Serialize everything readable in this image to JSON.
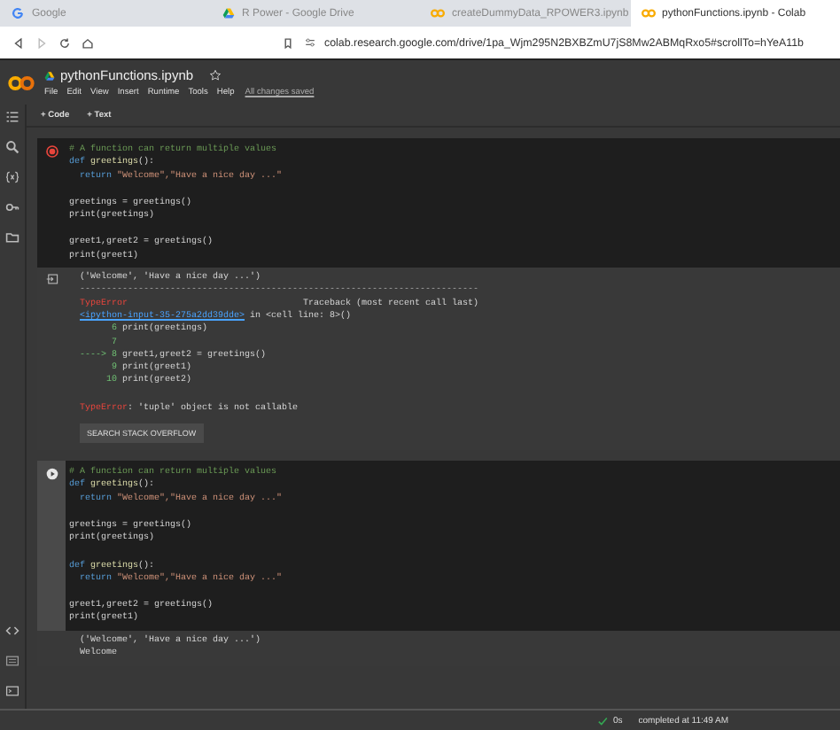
{
  "browser_tabs": [
    {
      "label": "Google",
      "kind": "google",
      "selected": false
    },
    {
      "label": "R Power - Google Drive",
      "kind": "drive",
      "selected": false
    },
    {
      "label": "createDummyData_RPOWER3.ipynb",
      "kind": "colab",
      "selected": false
    },
    {
      "label": "pythonFunctions.ipynb - Colab",
      "kind": "colab",
      "selected": true
    }
  ],
  "address_bar": {
    "url": "colab.research.google.com/drive/1pa_Wjm295N2BXBZmU7jS8Mw2ABMqRxo5#scrollTo=hYeA11b"
  },
  "notebook": {
    "title": "pythonFunctions.ipynb",
    "menu": [
      "File",
      "Edit",
      "View",
      "Insert",
      "Runtime",
      "Tools",
      "Help"
    ],
    "save_status": "All changes saved"
  },
  "toolbar": [
    "+ Code",
    "+ Text"
  ],
  "cells": [
    {
      "error": true,
      "code": [
        {
          "tokens": [
            {
              "kind": "comment",
              "text": "# A function can return multiple values"
            }
          ]
        },
        {
          "tokens": [
            {
              "kind": "keyword",
              "text": "def "
            },
            {
              "kind": "function",
              "text": "greetings"
            },
            {
              "kind": "plain",
              "text": "():"
            }
          ]
        },
        {
          "tokens": [
            {
              "kind": "keyword",
              "text": "  return "
            },
            {
              "kind": "string",
              "text": "\"Welcome\",\"Have a nice day ...\""
            }
          ]
        },
        {
          "gap_before": true,
          "tokens": [
            {
              "kind": "plain",
              "text": "greetings = greetings()"
            }
          ]
        },
        {
          "tokens": [
            {
              "kind": "plain",
              "text": "print(greetings)"
            }
          ]
        },
        {
          "gap_before": true,
          "tokens": [
            {
              "kind": "plain",
              "text": "greet1,greet2 = greetings()"
            }
          ]
        },
        {
          "tokens": [
            {
              "kind": "plain",
              "text": "print(greet1)"
            }
          ]
        }
      ],
      "output": [
        {
          "tokens": [
            {
              "kind": "plain",
              "text": "('Welcome', 'Have a nice day ...')"
            }
          ]
        },
        {
          "tokens": [
            {
              "kind": "dashes",
              "text": "---------------------------------------------------------------------------"
            }
          ]
        },
        {
          "tokens": [
            {
              "kind": "error",
              "text": "TypeError"
            },
            {
              "kind": "plain",
              "text": "                                 Traceback (most recent call last)"
            }
          ]
        },
        {
          "tokens": [
            {
              "kind": "link",
              "text": "<ipython-input-35-275a2dd39dde>"
            },
            {
              "kind": "plain",
              "text": " in <cell line: 8>()"
            }
          ]
        },
        {
          "tokens": [
            {
              "kind": "number",
              "text": "      6 "
            },
            {
              "kind": "plain",
              "text": "print(greetings)"
            }
          ]
        },
        {
          "tokens": [
            {
              "kind": "number",
              "text": "      7"
            }
          ]
        },
        {
          "tokens": [
            {
              "kind": "arrow",
              "text": "----> 8 "
            },
            {
              "kind": "plain",
              "text": "greet1,greet2 = greetings()"
            }
          ]
        },
        {
          "tokens": [
            {
              "kind": "number",
              "text": "      9 "
            },
            {
              "kind": "plain",
              "text": "print(greet1)"
            }
          ]
        },
        {
          "tokens": [
            {
              "kind": "number",
              "text": "     10 "
            },
            {
              "kind": "plain",
              "text": "print(greet2)"
            }
          ]
        },
        {
          "gap_before": true,
          "tokens": [
            {
              "kind": "error",
              "text": "TypeError"
            },
            {
              "kind": "plain",
              "text": ": 'tuple' object is not callable"
            }
          ]
        }
      ],
      "output_button": "SEARCH STACK OVERFLOW"
    },
    {
      "error": false,
      "code": [
        {
          "tokens": [
            {
              "kind": "comment",
              "text": "# A function can return multiple values"
            }
          ]
        },
        {
          "tokens": [
            {
              "kind": "keyword",
              "text": "def "
            },
            {
              "kind": "function",
              "text": "greetings"
            },
            {
              "kind": "plain",
              "text": "():"
            }
          ]
        },
        {
          "tokens": [
            {
              "kind": "keyword",
              "text": "  return "
            },
            {
              "kind": "string",
              "text": "\"Welcome\",\"Have a nice day ...\""
            }
          ]
        },
        {
          "gap_before": true,
          "tokens": [
            {
              "kind": "plain",
              "text": "greetings = greetings()"
            }
          ]
        },
        {
          "tokens": [
            {
              "kind": "plain",
              "text": "print(greetings)"
            }
          ]
        },
        {
          "gap_before": true,
          "tokens": [
            {
              "kind": "keyword",
              "text": "def "
            },
            {
              "kind": "function",
              "text": "greetings"
            },
            {
              "kind": "plain",
              "text": "():"
            }
          ]
        },
        {
          "tokens": [
            {
              "kind": "keyword",
              "text": "  return "
            },
            {
              "kind": "string",
              "text": "\"Welcome\",\"Have a nice day ...\""
            }
          ]
        },
        {
          "gap_before": true,
          "tokens": [
            {
              "kind": "plain",
              "text": "greet1,greet2 = greetings()"
            }
          ]
        },
        {
          "tokens": [
            {
              "kind": "plain",
              "text": "print(greet1)"
            }
          ]
        }
      ],
      "output": [
        {
          "tokens": [
            {
              "kind": "plain",
              "text": "('Welcome', 'Have a nice day ...')"
            }
          ]
        },
        {
          "tokens": [
            {
              "kind": "plain",
              "text": "Welcome"
            }
          ]
        }
      ]
    }
  ],
  "status_bar": {
    "duration": "0s",
    "message": "completed at 11:49 AM"
  }
}
